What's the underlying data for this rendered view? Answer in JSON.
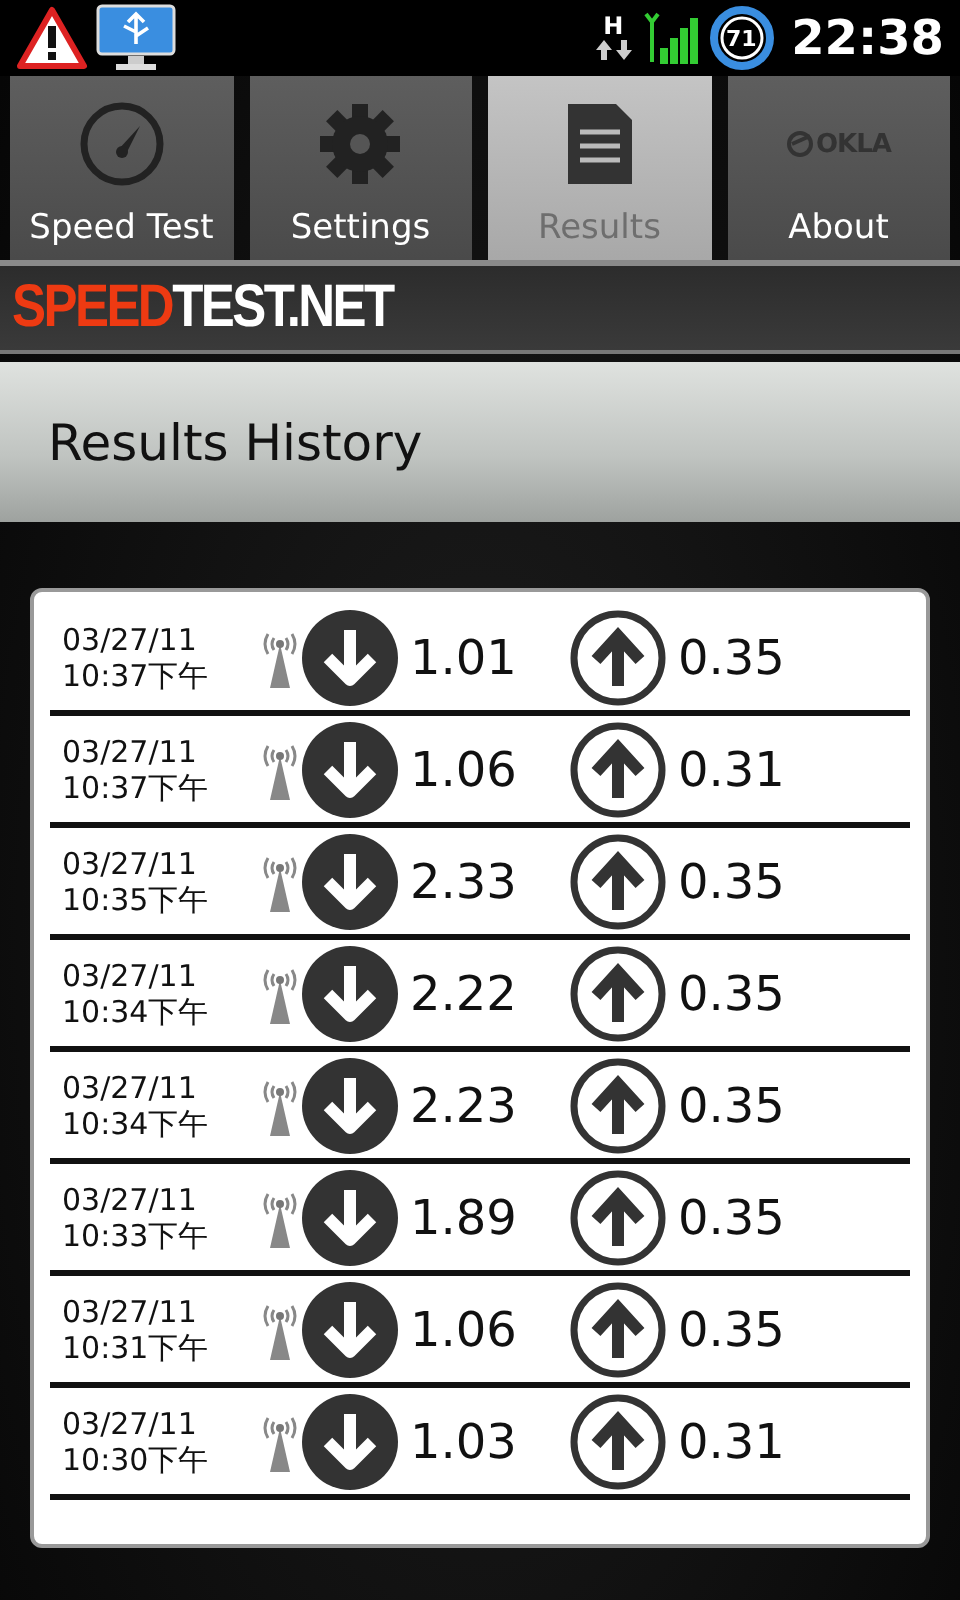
{
  "status_bar": {
    "network": "H",
    "battery": "71",
    "time": "22:38"
  },
  "tabs": [
    {
      "label": "Speed Test",
      "kind": "gauge",
      "selected": false
    },
    {
      "label": "Settings",
      "kind": "gear",
      "selected": false
    },
    {
      "label": "Results",
      "kind": "document",
      "selected": true
    },
    {
      "label": "About",
      "kind": "logo",
      "logo_text": "OKLA",
      "selected": false
    }
  ],
  "brand": {
    "part_1": "SPEED",
    "part_2": "TEST.NET"
  },
  "header": {
    "title": "Results History"
  },
  "results": [
    {
      "date": "03/27/11",
      "time": "10:37下午",
      "download": "1.01",
      "upload": "0.35"
    },
    {
      "date": "03/27/11",
      "time": "10:37下午",
      "download": "1.06",
      "upload": "0.31"
    },
    {
      "date": "03/27/11",
      "time": "10:35下午",
      "download": "2.33",
      "upload": "0.35"
    },
    {
      "date": "03/27/11",
      "time": "10:34下午",
      "download": "2.22",
      "upload": "0.35"
    },
    {
      "date": "03/27/11",
      "time": "10:34下午",
      "download": "2.23",
      "upload": "0.35"
    },
    {
      "date": "03/27/11",
      "time": "10:33下午",
      "download": "1.89",
      "upload": "0.35"
    },
    {
      "date": "03/27/11",
      "time": "10:31下午",
      "download": "1.06",
      "upload": "0.35"
    },
    {
      "date": "03/27/11",
      "time": "10:30下午",
      "download": "1.03",
      "upload": "0.31"
    }
  ]
}
